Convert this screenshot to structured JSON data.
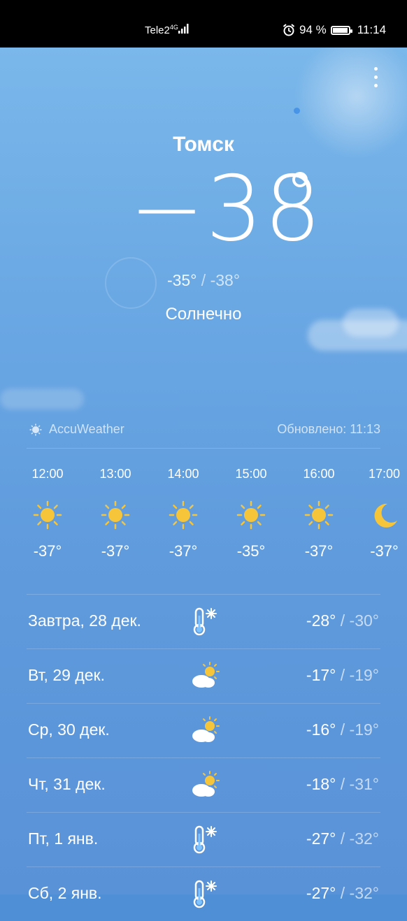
{
  "status_bar": {
    "carrier": "Tele2",
    "network": "4G",
    "battery": "94 %",
    "time": "11:14"
  },
  "location": "Томск",
  "current": {
    "temperature": "−38",
    "high": "-35°",
    "low": "-38°",
    "separator": "/",
    "condition": "Солнечно"
  },
  "source": {
    "provider": "AccuWeather",
    "updated": "Обновлено: 11:13"
  },
  "hourly": [
    {
      "time": "12:00",
      "icon": "sun-icon",
      "temp": "-37°"
    },
    {
      "time": "13:00",
      "icon": "sun-icon",
      "temp": "-37°"
    },
    {
      "time": "14:00",
      "icon": "sun-icon",
      "temp": "-37°"
    },
    {
      "time": "15:00",
      "icon": "sun-icon",
      "temp": "-35°"
    },
    {
      "time": "16:00",
      "icon": "sun-icon",
      "temp": "-37°"
    },
    {
      "time": "17:00",
      "icon": "moon-icon",
      "temp": "-37°"
    }
  ],
  "daily": [
    {
      "day": "Завтра, 28 дек.",
      "icon": "cold-thermometer-icon",
      "high": "-28°",
      "low": "-30°"
    },
    {
      "day": "Вт, 29 дек.",
      "icon": "partly-cloudy-icon",
      "high": "-17°",
      "low": "-19°"
    },
    {
      "day": "Ср, 30 дек.",
      "icon": "partly-cloudy-icon",
      "high": "-16°",
      "low": "-19°"
    },
    {
      "day": "Чт, 31 дек.",
      "icon": "partly-cloudy-icon",
      "high": "-18°",
      "low": "-31°"
    },
    {
      "day": "Пт, 1 янв.",
      "icon": "cold-thermometer-icon",
      "high": "-27°",
      "low": "-32°"
    },
    {
      "day": "Сб, 2 янв.",
      "icon": "cold-thermometer-icon",
      "high": "-27°",
      "low": "-32°"
    }
  ],
  "colors": {
    "sun": "#f7c53a",
    "sky_top": "#7ab7ea",
    "sky_bottom": "#5a92d8"
  }
}
